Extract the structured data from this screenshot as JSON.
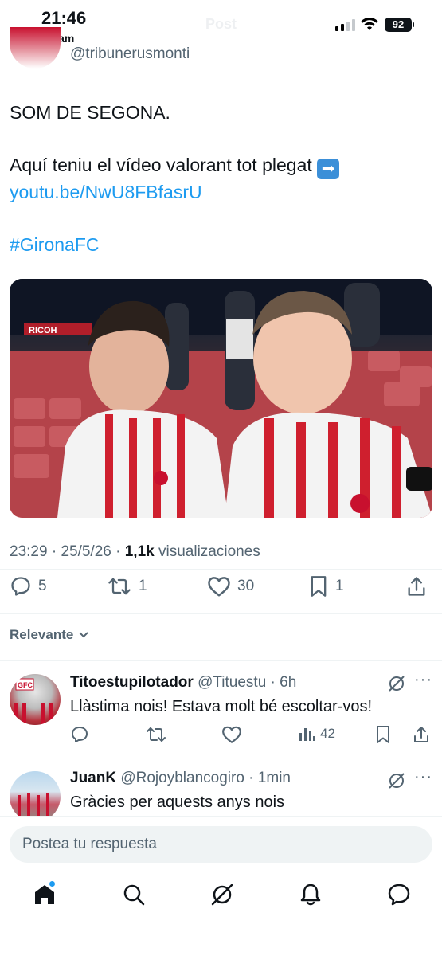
{
  "status_bar": {
    "time": "21:46",
    "back_label": "Instagram",
    "battery": "92",
    "title": "Post"
  },
  "author": {
    "handle": "@tribunerusmonti"
  },
  "post": {
    "line1": "SOM DE SEGONA.",
    "line2": "Aquí teniu el vídeo valorant tot plegat",
    "link": "youtu.be/NwU8FBfasrU",
    "hashtag": "#GironaFC",
    "time": "23:29",
    "date": "25/5/26",
    "views_count": "1,1k",
    "views_label": "visualizaciones"
  },
  "actions": {
    "replies": "5",
    "reposts": "1",
    "likes": "30",
    "bookmarks": "1"
  },
  "sort": {
    "label": "Relevante"
  },
  "replies": [
    {
      "name": "Titoestupilotador",
      "handle": "@Tituestu",
      "time": "6h",
      "text": "Llàstima nois! Estava molt bé escoltar-vos!",
      "views": "42"
    },
    {
      "name": "JuanK",
      "handle": "@Rojoyblancogiro",
      "time": "1min",
      "text": "Gràcies per aquests anys nois"
    }
  ],
  "reply_box": {
    "placeholder": "Postea tu respuesta"
  },
  "colors": {
    "accent": "#1d9bf0",
    "text": "#0f1419",
    "secondary": "#536471"
  },
  "icons": {
    "nav": [
      "home-icon",
      "search-icon",
      "grok-icon",
      "notifications-icon",
      "messages-icon"
    ]
  }
}
